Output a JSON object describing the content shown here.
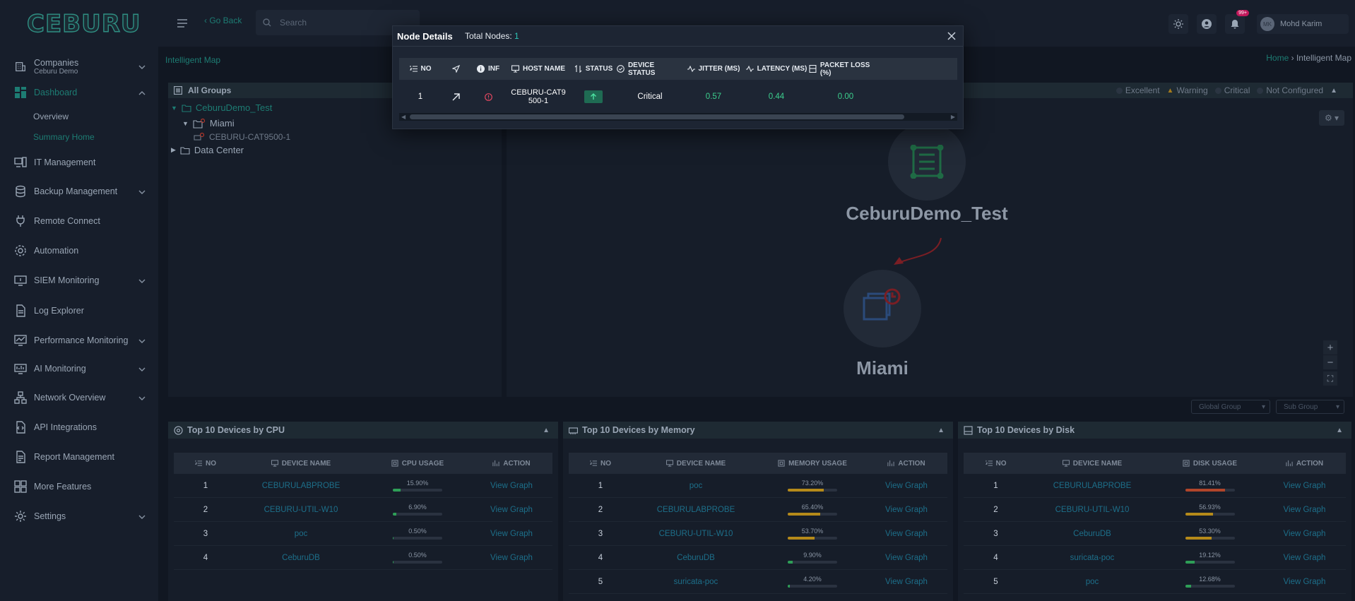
{
  "app": {
    "logo": "CEBURU"
  },
  "sidebar": {
    "companies": {
      "label": "Companies",
      "sub": "Ceburu Demo"
    },
    "items": [
      {
        "key": "dashboard",
        "label": "Dashboard",
        "icon": "grid-icon"
      },
      {
        "key": "overview",
        "label": "Overview"
      },
      {
        "key": "summary",
        "label": "Summary Home"
      },
      {
        "key": "it",
        "label": "IT Management"
      },
      {
        "key": "backup",
        "label": "Backup Management"
      },
      {
        "key": "remote",
        "label": "Remote Connect"
      },
      {
        "key": "automation",
        "label": "Automation"
      },
      {
        "key": "siem",
        "label": "SIEM Monitoring"
      },
      {
        "key": "log",
        "label": "Log Explorer"
      },
      {
        "key": "perf",
        "label": "Performance Monitoring"
      },
      {
        "key": "ai",
        "label": "AI Monitoring"
      },
      {
        "key": "network",
        "label": "Network Overview"
      },
      {
        "key": "api",
        "label": "API Integrations"
      },
      {
        "key": "report",
        "label": "Report Management"
      },
      {
        "key": "more",
        "label": "More Features"
      },
      {
        "key": "settings",
        "label": "Settings"
      }
    ]
  },
  "topbar": {
    "go_back": "‹ Go Back",
    "search_placeholder": "Search",
    "notif_count": "99+",
    "user_initials": "MK",
    "user_name": "Mohd Karim"
  },
  "breadcrumb": {
    "page": "Intelligent Map",
    "home": "Home",
    "sep": "›",
    "current": "Intelligent Map"
  },
  "groups": {
    "title": "All Groups",
    "root": "CeburuDemo_Test",
    "child": "Miami",
    "device": "CEBURU-CAT9500-1",
    "other": "Data Center"
  },
  "legend": [
    "Excellent",
    "Warning",
    "Critical",
    "Not Configured"
  ],
  "map": {
    "node1": "CeburuDemo_Test",
    "node2": "Miami",
    "zoom_in": "+",
    "zoom_out": "−",
    "fit": "⛶"
  },
  "filters": {
    "global": "Global Group",
    "sub": "Sub Group"
  },
  "cpu": {
    "title": "Top 10 Devices by CPU",
    "headers": [
      "NO",
      "DEVICE NAME",
      "CPU USAGE",
      "ACTION"
    ],
    "rows": [
      {
        "no": "1",
        "name": "CEBURULABPROBE",
        "pct": "15.90%",
        "val": 15.9,
        "action": "View Graph"
      },
      {
        "no": "2",
        "name": "CEBURU-UTIL-W10",
        "pct": "6.90%",
        "val": 6.9,
        "action": "View Graph"
      },
      {
        "no": "3",
        "name": "poc",
        "pct": "0.50%",
        "val": 0.5,
        "action": "View Graph"
      },
      {
        "no": "4",
        "name": "CeburuDB",
        "pct": "0.50%",
        "val": 0.5,
        "action": "View Graph"
      }
    ]
  },
  "memory": {
    "title": "Top 10 Devices by Memory",
    "headers": [
      "NO",
      "DEVICE NAME",
      "MEMORY USAGE",
      "ACTION"
    ],
    "rows": [
      {
        "no": "1",
        "name": "poc",
        "pct": "73.20%",
        "val": 73.2,
        "action": "View Graph"
      },
      {
        "no": "2",
        "name": "CEBURULABPROBE",
        "pct": "65.40%",
        "val": 65.4,
        "action": "View Graph"
      },
      {
        "no": "3",
        "name": "CEBURU-UTIL-W10",
        "pct": "53.70%",
        "val": 53.7,
        "action": "View Graph"
      },
      {
        "no": "4",
        "name": "CeburuDB",
        "pct": "9.90%",
        "val": 9.9,
        "action": "View Graph"
      },
      {
        "no": "5",
        "name": "suricata-poc",
        "pct": "4.20%",
        "val": 4.2,
        "action": "View Graph"
      }
    ]
  },
  "disk": {
    "title": "Top 10 Devices by Disk",
    "headers": [
      "NO",
      "DEVICE NAME",
      "DISK USAGE",
      "ACTION"
    ],
    "rows": [
      {
        "no": "1",
        "name": "CEBURULABPROBE",
        "pct": "81.41%",
        "val": 81.41,
        "action": "View Graph"
      },
      {
        "no": "2",
        "name": "CEBURU-UTIL-W10",
        "pct": "56.93%",
        "val": 56.93,
        "action": "View Graph"
      },
      {
        "no": "3",
        "name": "CeburuDB",
        "pct": "53.30%",
        "val": 53.3,
        "action": "View Graph"
      },
      {
        "no": "4",
        "name": "suricata-poc",
        "pct": "19.12%",
        "val": 19.12,
        "action": "View Graph"
      },
      {
        "no": "5",
        "name": "poc",
        "pct": "12.68%",
        "val": 12.68,
        "action": "View Graph"
      }
    ]
  },
  "modal": {
    "title": "Node Details",
    "total_label": "Total Nodes:",
    "total": "1",
    "headers": [
      "NO",
      "",
      "INF",
      "HOST NAME",
      "STATUS",
      "DEVICE STATUS",
      "JITTER (MS)",
      "LATENCY (MS)",
      "PACKET LOSS (%)"
    ],
    "row": {
      "no": "1",
      "host": "CEBURU-CAT9500-1",
      "device_status": "Critical",
      "jitter": "0.57",
      "latency": "0.44",
      "loss": "0.00"
    }
  },
  "colors": {
    "accent": "#1d7c73",
    "green": "#3ccf8e",
    "bar_green": "#2e9e57",
    "bar_yellow": "#b58a1a",
    "bar_red": "#b0452a"
  }
}
